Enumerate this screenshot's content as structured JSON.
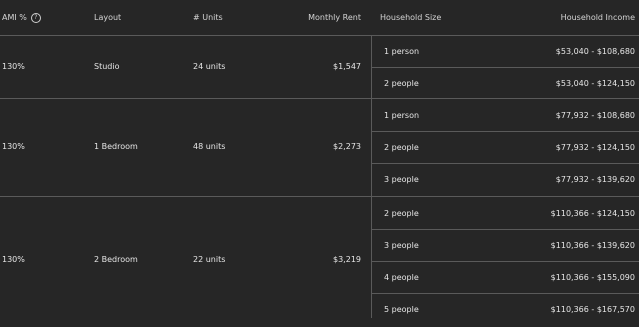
{
  "headers": {
    "ami": "AMI %",
    "layout": "Layout",
    "units": "# Units",
    "rent": "Monthly Rent",
    "household_size": "Household Size",
    "household_income": "Household Income"
  },
  "rows": [
    {
      "ami": "130%",
      "layout": "Studio",
      "units": "24 units",
      "rent": "$1,547",
      "sizes": [
        {
          "size": "1 person",
          "income": "$53,040 - $108,680"
        },
        {
          "size": "2 people",
          "income": "$53,040 - $124,150"
        }
      ]
    },
    {
      "ami": "130%",
      "layout": "1 Bedroom",
      "units": "48 units",
      "rent": "$2,273",
      "sizes": [
        {
          "size": "1 person",
          "income": "$77,932 - $108,680"
        },
        {
          "size": "2 people",
          "income": "$77,932 - $124,150"
        },
        {
          "size": "3 people",
          "income": "$77,932 - $139,620"
        }
      ]
    },
    {
      "ami": "130%",
      "layout": "2 Bedroom",
      "units": "22 units",
      "rent": "$3,219",
      "sizes": [
        {
          "size": "2 people",
          "income": "$110,366 - $124,150"
        },
        {
          "size": "3 people",
          "income": "$110,366 - $139,620"
        },
        {
          "size": "4 people",
          "income": "$110,366 - $155,090"
        },
        {
          "size": "5 people",
          "income": "$110,366 - $167,570"
        }
      ]
    }
  ]
}
